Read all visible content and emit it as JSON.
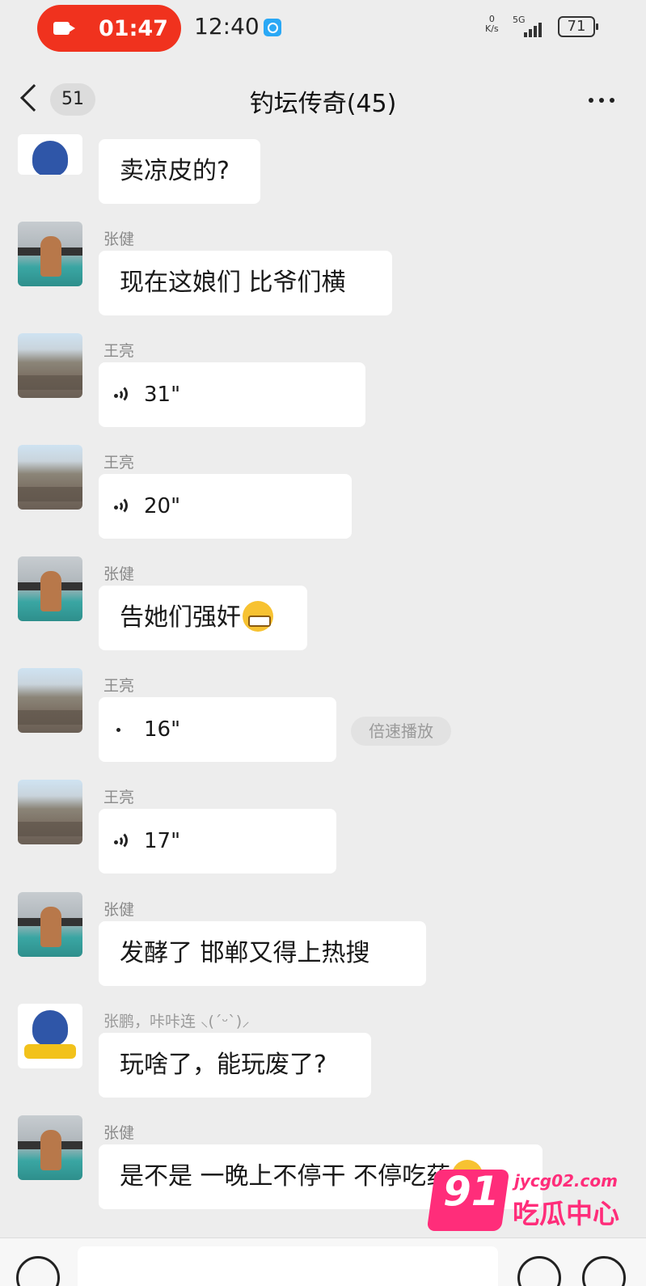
{
  "status_bar": {
    "recording_time": "01:47",
    "clock": "12:40",
    "net_speed_value": "0",
    "net_speed_unit": "K/s",
    "network": "5G",
    "battery": "71"
  },
  "header": {
    "unread_count": "51",
    "title": "钓坛传奇(45)"
  },
  "messages": [
    {
      "sender": "",
      "text": "卖凉皮的?"
    },
    {
      "sender": "张健",
      "text": "现在这娘们 比爷们横"
    },
    {
      "sender": "王亮",
      "voice_duration": "31\""
    },
    {
      "sender": "王亮",
      "voice_duration": "20\""
    },
    {
      "sender": "张健",
      "text": "告她们强奸"
    },
    {
      "sender": "王亮",
      "voice_duration": "16\"",
      "speed_label": "倍速播放"
    },
    {
      "sender": "王亮",
      "voice_duration": "17\""
    },
    {
      "sender": "张健",
      "text": "发酵了  邯郸又得上热搜"
    },
    {
      "sender": "张鹏，咔咔连 ⸜(ˊᵕˋ)⸝",
      "text": "玩啥了，能玩废了?"
    },
    {
      "sender": "张健",
      "text": "是不是 一晚上不停干  不停吃药"
    }
  ],
  "watermark": {
    "number": "91",
    "url": "jycg02.com",
    "text": "吃瓜中心"
  },
  "colors": {
    "background": "#ededed",
    "bubble": "#ffffff",
    "record_pill": "#f0321e",
    "watermark": "#ff2d7a"
  }
}
